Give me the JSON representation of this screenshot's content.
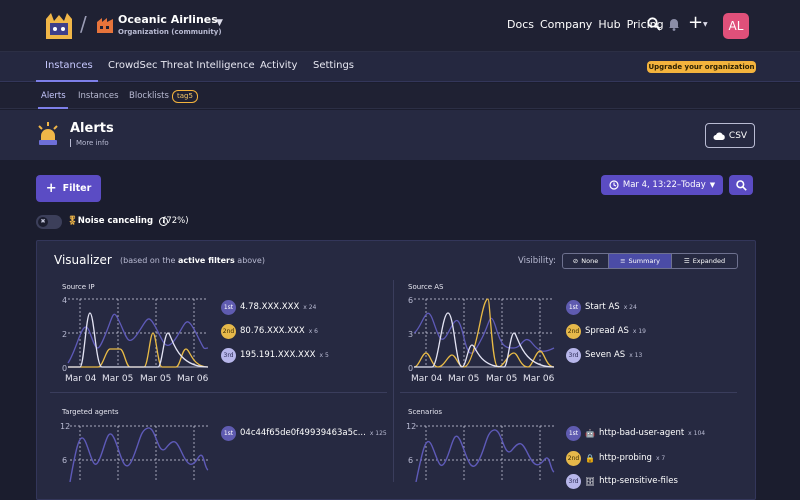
{
  "org": {
    "name": "Oceanic Airlines",
    "subtitle": "Organization (community)"
  },
  "top_nav": [
    "Docs",
    "Company",
    "Hub",
    "Pricing"
  ],
  "user": {
    "initials": "AL"
  },
  "tabs": [
    {
      "label": "Instances",
      "active": true
    },
    {
      "label": "CrowdSec Threat Intelligence",
      "active": false
    },
    {
      "label": "Activity",
      "active": false
    },
    {
      "label": "Settings",
      "active": false
    }
  ],
  "upgrade_label": "Upgrade your organization",
  "subtabs": [
    {
      "label": "Alerts",
      "active": true
    },
    {
      "label": "Instances",
      "active": false
    },
    {
      "label": "Blocklists",
      "active": false
    }
  ],
  "subtab_tag": "tag5",
  "page": {
    "title": "Alerts",
    "more_info": "More info",
    "csv_label": "CSV"
  },
  "filter_label": "Filter",
  "date_range": "Mar 4, 13:22–Today",
  "noise": {
    "label": "Noise canceling",
    "percent": "(72%)"
  },
  "visualizer": {
    "title": "Visualizer",
    "sub_prefix": "(based on the ",
    "sub_bold": "active filters",
    "sub_suffix": " above)",
    "visibility_label": "Visibility:",
    "options": [
      {
        "label": "None",
        "active": false
      },
      {
        "label": "Summary",
        "active": true
      },
      {
        "label": "Expanded",
        "active": false
      }
    ]
  },
  "panels": [
    {
      "title": "Source IP",
      "y_ticks": [
        "4",
        "2",
        "0"
      ],
      "x_ticks": [
        "Mar 04",
        "Mar 05",
        "Mar 05",
        "Mar 06"
      ],
      "top": [
        {
          "rank": "1st",
          "label": "4.78.XXX.XXX",
          "count": "x 24"
        },
        {
          "rank": "2nd",
          "label": "80.76.XXX.XXX",
          "count": "x 6"
        },
        {
          "rank": "3rd",
          "label": "195.191.XXX.XXX",
          "count": "x 5"
        }
      ]
    },
    {
      "title": "Source AS",
      "y_ticks": [
        "6",
        "3",
        "0"
      ],
      "x_ticks": [
        "Mar 04",
        "Mar 05",
        "Mar 05",
        "Mar 06"
      ],
      "top": [
        {
          "rank": "1st",
          "label": "Start AS",
          "count": "x 24"
        },
        {
          "rank": "2nd",
          "label": "Spread AS",
          "count": "x 19"
        },
        {
          "rank": "3rd",
          "label": "Seven AS",
          "count": "x 13"
        }
      ]
    },
    {
      "title": "Targeted agents",
      "y_ticks": [
        "12",
        "6"
      ],
      "top": [
        {
          "rank": "1st",
          "label": "04c44f65de0f49939463a5c...",
          "count": "x 125"
        }
      ]
    },
    {
      "title": "Scenarios",
      "y_ticks": [
        "12",
        "6"
      ],
      "top": [
        {
          "rank": "1st",
          "emoji": "🤖",
          "label": "http-bad-user-agent",
          "count": "x 104"
        },
        {
          "rank": "2nd",
          "emoji": "🔒",
          "label": "http-probing",
          "count": "x 7"
        },
        {
          "rank": "3rd",
          "emoji": "🗄",
          "label": "http-sensitive-files",
          "count": ""
        }
      ]
    }
  ],
  "colors": {
    "series_1": "#5e5ab8",
    "series_2": "#e9bb46",
    "series_3": "#e4e4f4"
  }
}
